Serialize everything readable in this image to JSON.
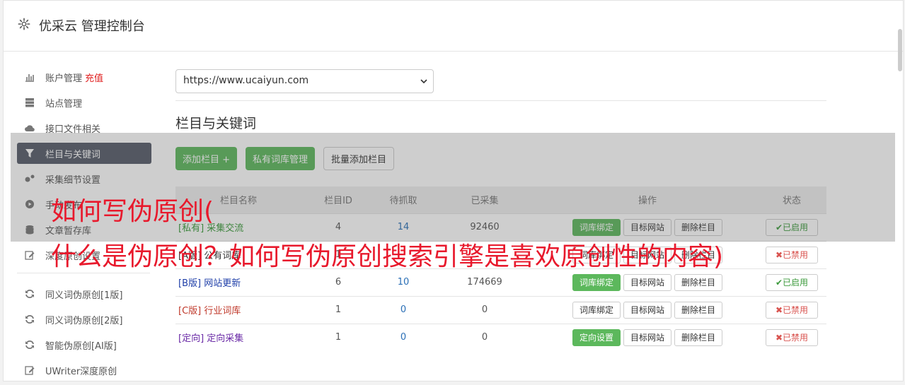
{
  "header": {
    "title": "优采云 管理控制台",
    "icon": "gear-icon"
  },
  "sidebar": {
    "items": [
      {
        "label": "账户管理",
        "extra": "充值",
        "icon": "bar-chart-icon"
      },
      {
        "label": "站点管理",
        "icon": "server-icon"
      },
      {
        "label": "接口文件相关",
        "icon": "cloud-upload-icon"
      },
      {
        "label": "栏目与关键词",
        "icon": "filter-icon",
        "active": true
      },
      {
        "label": "采集细节设置",
        "icon": "gears-icon"
      },
      {
        "label": "手动发布",
        "icon": "play-circle-icon"
      },
      {
        "label": "文章暂存库",
        "icon": "database-icon"
      },
      {
        "label": "深度原创设置",
        "icon": "edit-icon"
      }
    ],
    "items2": [
      {
        "label": "同义词伪原创[1版]",
        "icon": "refresh-icon"
      },
      {
        "label": "同义词伪原创[2版]",
        "icon": "refresh-icon"
      },
      {
        "label": "智能伪原创[AI版]",
        "icon": "refresh-icon"
      },
      {
        "label": "UWriter深度原创",
        "icon": "edit-icon"
      }
    ]
  },
  "main": {
    "site_select": "https://www.ucaiyun.com",
    "section_title": "栏目与关键词",
    "buttons": {
      "add_column": "添加栏目 +",
      "private_lib": "私有词库管理",
      "batch_add": "批量添加栏目"
    },
    "table": {
      "headers": [
        "栏目名称",
        "栏目ID",
        "待抓取",
        "已采集",
        "操作",
        "状态"
      ],
      "rows": [
        {
          "tag": "[私有]",
          "name": "采集交流",
          "id": "4",
          "pending": "14",
          "collected": "92460",
          "op1": "词库绑定",
          "op2": "目标网站",
          "op3": "删除栏目",
          "status": "已启用",
          "on": true,
          "cls": "c-green"
        },
        {
          "tag": "[A版]",
          "name": "公有词库",
          "id": "1",
          "pending": "",
          "collected": "",
          "op1": "词库绑定",
          "op2": "目标网站",
          "op3": "删除栏目",
          "status": "已禁用",
          "on": false,
          "cls": "c-black"
        },
        {
          "tag": "[B版]",
          "name": "网站更新",
          "id": "6",
          "pending": "10",
          "collected": "174669",
          "op1": "词库绑定",
          "op2": "目标网站",
          "op3": "删除栏目",
          "status": "已启用",
          "on": true,
          "cls": "c-navy"
        },
        {
          "tag": "[C版]",
          "name": "行业词库",
          "id": "1",
          "pending": "0",
          "collected": "0",
          "op1": "词库绑定",
          "op2": "目标网站",
          "op3": "删除栏目",
          "status": "已禁用",
          "on": false,
          "cls": "c-red"
        },
        {
          "tag": "[定向]",
          "name": "定向采集",
          "id": "1",
          "pending": "0",
          "collected": "0",
          "op1": "定向设置",
          "op2": "目标网站",
          "op3": "删除栏目",
          "status": "已禁用",
          "on": false,
          "cls": "c-purple"
        }
      ]
    }
  },
  "overlay": {
    "line1": "如何写伪原创(",
    "line2": "什么是伪原创？如何写伪原创搜索引擎是喜欢原创性的内容)"
  }
}
